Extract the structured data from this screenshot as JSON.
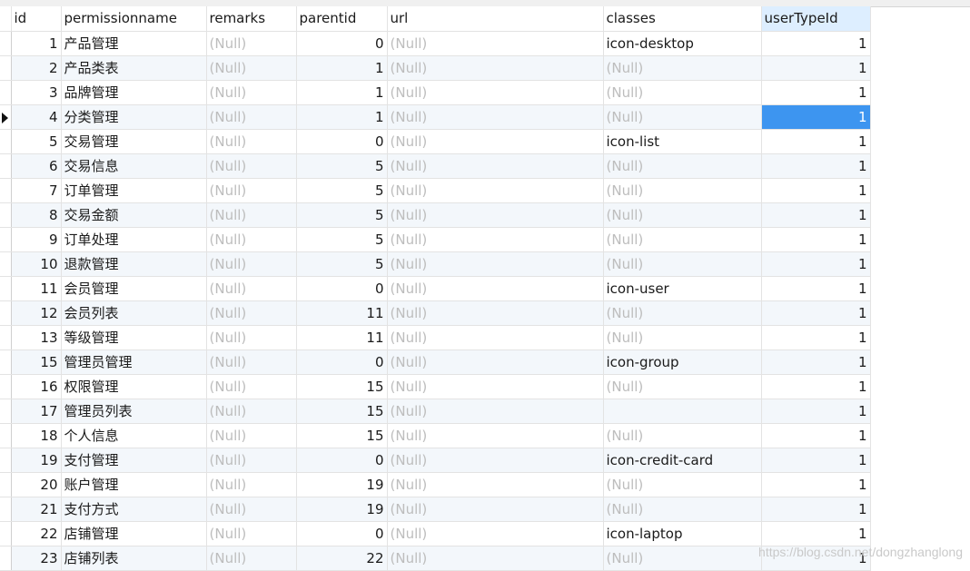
{
  "table": {
    "columns": [
      "id",
      "permissionname",
      "remarks",
      "parentid",
      "url",
      "classes",
      "userTypeId"
    ],
    "selected_column": "userTypeId",
    "current_row_id": 4,
    "rows": [
      {
        "id": "1",
        "permissionname": "产品管理",
        "remarks": "(Null)",
        "parentid": "0",
        "url": "(Null)",
        "classes": "icon-desktop",
        "userTypeId": "1"
      },
      {
        "id": "2",
        "permissionname": "产品类表",
        "remarks": "(Null)",
        "parentid": "1",
        "url": "(Null)",
        "classes": "(Null)",
        "userTypeId": "1"
      },
      {
        "id": "3",
        "permissionname": "品牌管理",
        "remarks": "(Null)",
        "parentid": "1",
        "url": "(Null)",
        "classes": "(Null)",
        "userTypeId": "1"
      },
      {
        "id": "4",
        "permissionname": "分类管理",
        "remarks": "(Null)",
        "parentid": "1",
        "url": "(Null)",
        "classes": "(Null)",
        "userTypeId": "1"
      },
      {
        "id": "5",
        "permissionname": "交易管理",
        "remarks": "(Null)",
        "parentid": "0",
        "url": "(Null)",
        "classes": "icon-list",
        "userTypeId": "1"
      },
      {
        "id": "6",
        "permissionname": "交易信息",
        "remarks": "(Null)",
        "parentid": "5",
        "url": "(Null)",
        "classes": "(Null)",
        "userTypeId": "1"
      },
      {
        "id": "7",
        "permissionname": "订单管理",
        "remarks": "(Null)",
        "parentid": "5",
        "url": "(Null)",
        "classes": "(Null)",
        "userTypeId": "1"
      },
      {
        "id": "8",
        "permissionname": "交易金额",
        "remarks": "(Null)",
        "parentid": "5",
        "url": "(Null)",
        "classes": "(Null)",
        "userTypeId": "1"
      },
      {
        "id": "9",
        "permissionname": "订单处理",
        "remarks": "(Null)",
        "parentid": "5",
        "url": "(Null)",
        "classes": "(Null)",
        "userTypeId": "1"
      },
      {
        "id": "10",
        "permissionname": "退款管理",
        "remarks": "(Null)",
        "parentid": "5",
        "url": "(Null)",
        "classes": "(Null)",
        "userTypeId": "1"
      },
      {
        "id": "11",
        "permissionname": "会员管理",
        "remarks": "(Null)",
        "parentid": "0",
        "url": "(Null)",
        "classes": "icon-user",
        "userTypeId": "1"
      },
      {
        "id": "12",
        "permissionname": "会员列表",
        "remarks": "(Null)",
        "parentid": "11",
        "url": "(Null)",
        "classes": "(Null)",
        "userTypeId": "1"
      },
      {
        "id": "13",
        "permissionname": "等级管理",
        "remarks": "(Null)",
        "parentid": "11",
        "url": "(Null)",
        "classes": "(Null)",
        "userTypeId": "1"
      },
      {
        "id": "15",
        "permissionname": "管理员管理",
        "remarks": "(Null)",
        "parentid": "0",
        "url": "(Null)",
        "classes": "icon-group",
        "userTypeId": "1"
      },
      {
        "id": "16",
        "permissionname": "权限管理",
        "remarks": "(Null)",
        "parentid": "15",
        "url": "(Null)",
        "classes": "(Null)",
        "userTypeId": "1"
      },
      {
        "id": "17",
        "permissionname": "管理员列表",
        "remarks": "(Null)",
        "parentid": "15",
        "url": "(Null)",
        "classes": "",
        "userTypeId": "1"
      },
      {
        "id": "18",
        "permissionname": "个人信息",
        "remarks": "(Null)",
        "parentid": "15",
        "url": "(Null)",
        "classes": "(Null)",
        "userTypeId": "1"
      },
      {
        "id": "19",
        "permissionname": "支付管理",
        "remarks": "(Null)",
        "parentid": "0",
        "url": "(Null)",
        "classes": "icon-credit-card",
        "userTypeId": "1"
      },
      {
        "id": "20",
        "permissionname": "账户管理",
        "remarks": "(Null)",
        "parentid": "19",
        "url": "(Null)",
        "classes": "(Null)",
        "userTypeId": "1"
      },
      {
        "id": "21",
        "permissionname": "支付方式",
        "remarks": "(Null)",
        "parentid": "19",
        "url": "(Null)",
        "classes": "(Null)",
        "userTypeId": "1"
      },
      {
        "id": "22",
        "permissionname": "店铺管理",
        "remarks": "(Null)",
        "parentid": "0",
        "url": "(Null)",
        "classes": "icon-laptop",
        "userTypeId": "1"
      },
      {
        "id": "23",
        "permissionname": "店铺列表",
        "remarks": "(Null)",
        "parentid": "22",
        "url": "(Null)",
        "classes": "(Null)",
        "userTypeId": "1"
      }
    ]
  },
  "watermark": "https://blog.csdn.net/dongzhanglong"
}
